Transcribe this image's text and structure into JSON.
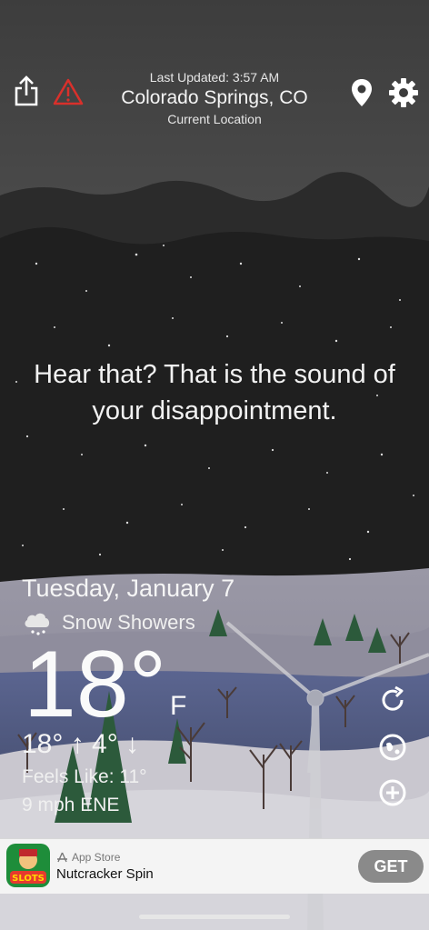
{
  "header": {
    "last_updated": "Last Updated: 3:57 AM",
    "city": "Colorado Springs, CO",
    "location_label": "Current Location",
    "share_icon": "share-icon",
    "alert_icon": "warning-icon",
    "pin_icon": "location-pin-icon",
    "settings_icon": "gear-icon"
  },
  "quote": "Hear that? That is the sound of your disappointment.",
  "weather": {
    "date": "Tuesday, January 7",
    "condition": "Snow Showers",
    "condition_icon": "snow-cloud-icon",
    "temperature": "18°",
    "unit": "F",
    "hi_lo": "18° ↑ 4° ↓",
    "feels_like": "Feels Like: 11°",
    "wind": "9 mph ENE"
  },
  "side_buttons": [
    "refresh-icon",
    "radar-icon",
    "add-icon"
  ],
  "ad": {
    "store_label": "App Store",
    "app_name": "Nutcracker Spin",
    "get_label": "GET",
    "icon_text": "SLOTS"
  },
  "colors": {
    "sky_top": "#3a3a3a",
    "sky_dark": "#1e1e1e",
    "alert_red": "#d9302b",
    "ad_button": "#8a8a8a"
  }
}
